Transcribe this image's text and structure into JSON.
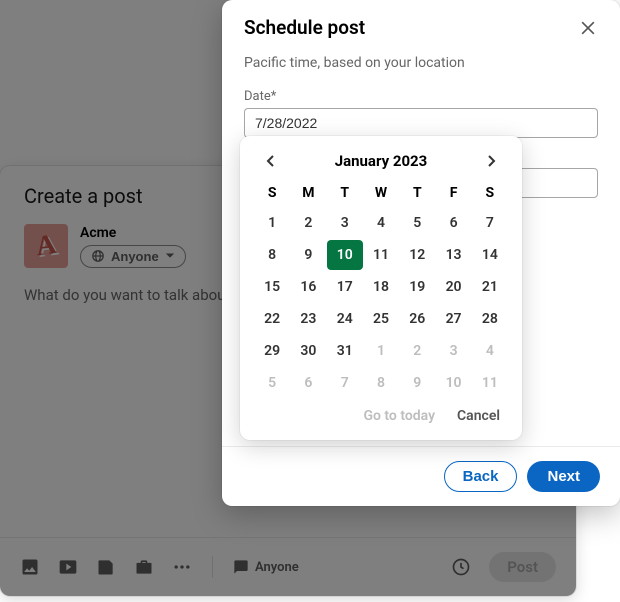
{
  "compose": {
    "header": "Create a post",
    "author_name": "Acme",
    "anyone_label": "Anyone",
    "placeholder": "What do you want to talk about?",
    "footer_anyone": "Anyone",
    "post_label": "Post"
  },
  "schedule": {
    "title": "Schedule post",
    "tz_info": "Pacific time, based on your location",
    "date_label": "Date*",
    "date_value": "7/28/2022",
    "back_label": "Back",
    "next_label": "Next"
  },
  "calendar": {
    "title": "January 2023",
    "dow": [
      "S",
      "M",
      "T",
      "W",
      "T",
      "F",
      "S"
    ],
    "go_today_label": "Go to today",
    "cancel_label": "Cancel",
    "cells": [
      {
        "d": "1",
        "m": false,
        "s": false
      },
      {
        "d": "2",
        "m": false,
        "s": false
      },
      {
        "d": "3",
        "m": false,
        "s": false
      },
      {
        "d": "4",
        "m": false,
        "s": false
      },
      {
        "d": "5",
        "m": false,
        "s": false
      },
      {
        "d": "6",
        "m": false,
        "s": false
      },
      {
        "d": "7",
        "m": false,
        "s": false
      },
      {
        "d": "8",
        "m": false,
        "s": false
      },
      {
        "d": "9",
        "m": false,
        "s": false
      },
      {
        "d": "10",
        "m": false,
        "s": true
      },
      {
        "d": "11",
        "m": false,
        "s": false
      },
      {
        "d": "12",
        "m": false,
        "s": false
      },
      {
        "d": "13",
        "m": false,
        "s": false
      },
      {
        "d": "14",
        "m": false,
        "s": false
      },
      {
        "d": "15",
        "m": false,
        "s": false
      },
      {
        "d": "16",
        "m": false,
        "s": false
      },
      {
        "d": "17",
        "m": false,
        "s": false
      },
      {
        "d": "18",
        "m": false,
        "s": false
      },
      {
        "d": "19",
        "m": false,
        "s": false
      },
      {
        "d": "20",
        "m": false,
        "s": false
      },
      {
        "d": "21",
        "m": false,
        "s": false
      },
      {
        "d": "22",
        "m": false,
        "s": false
      },
      {
        "d": "23",
        "m": false,
        "s": false
      },
      {
        "d": "24",
        "m": false,
        "s": false
      },
      {
        "d": "25",
        "m": false,
        "s": false
      },
      {
        "d": "26",
        "m": false,
        "s": false
      },
      {
        "d": "27",
        "m": false,
        "s": false
      },
      {
        "d": "28",
        "m": false,
        "s": false
      },
      {
        "d": "29",
        "m": false,
        "s": false
      },
      {
        "d": "30",
        "m": false,
        "s": false
      },
      {
        "d": "31",
        "m": false,
        "s": false
      },
      {
        "d": "1",
        "m": true,
        "s": false
      },
      {
        "d": "2",
        "m": true,
        "s": false
      },
      {
        "d": "3",
        "m": true,
        "s": false
      },
      {
        "d": "4",
        "m": true,
        "s": false
      },
      {
        "d": "5",
        "m": true,
        "s": false
      },
      {
        "d": "6",
        "m": true,
        "s": false
      },
      {
        "d": "7",
        "m": true,
        "s": false
      },
      {
        "d": "8",
        "m": true,
        "s": false
      },
      {
        "d": "9",
        "m": true,
        "s": false
      },
      {
        "d": "10",
        "m": true,
        "s": false
      },
      {
        "d": "11",
        "m": true,
        "s": false
      }
    ]
  }
}
